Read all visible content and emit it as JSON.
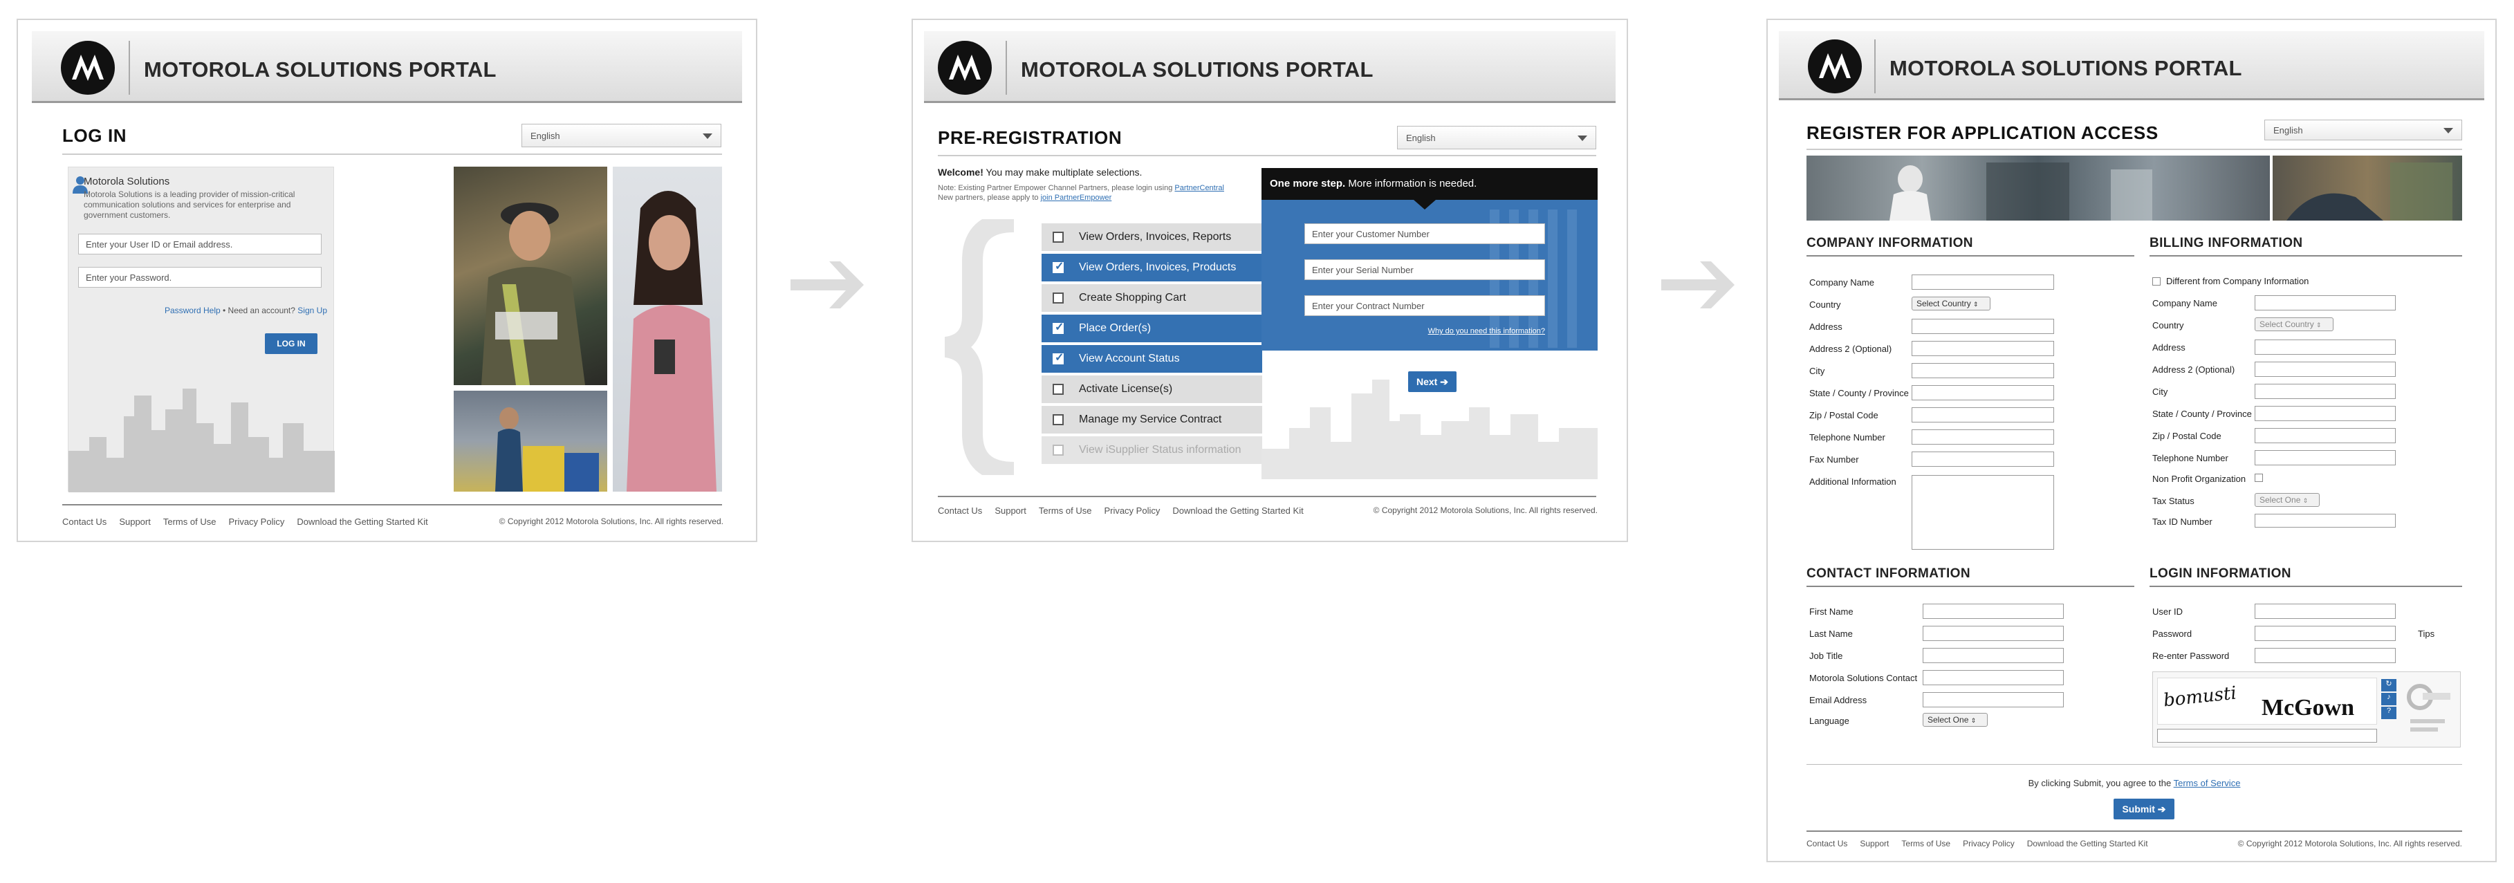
{
  "brand": {
    "title": "MOTOROLA SOLUTIONS PORTAL"
  },
  "language_select": {
    "value": "English"
  },
  "login": {
    "page_title": "LOG IN",
    "company_name": "Motorola Solutions",
    "company_desc": "Motorola Solutions is a leading provider of mission-critical communication solutions and services for enterprise and government customers.",
    "user_placeholder": "Enter your User ID or Email address.",
    "password_placeholder": "Enter your Password.",
    "password_help": "Password Help",
    "need_account": "• Need an account?",
    "sign_up": "Sign Up",
    "login_button": "LOG IN"
  },
  "footer": {
    "links": [
      "Contact Us",
      "Support",
      "Terms of Use",
      "Privacy Policy",
      "Download the Getting Started Kit"
    ],
    "copyright": "© Copyright 2012 Motorola Solutions, Inc. All rights reserved."
  },
  "prereg": {
    "page_title": "PRE-REGISTRATION",
    "welcome_bold": "Welcome!",
    "welcome_text": "You may make multiplate selections.",
    "note_line1": "Note: Existing Partner Empower Channel Partners, please login using",
    "note_link1": "PartnerCentral",
    "note_line2": "New partners, please apply to",
    "note_link2": "join PartnerEmpower",
    "options": [
      {
        "label": "View Orders, Invoices, Reports",
        "state": "off"
      },
      {
        "label": "View Orders, Invoices, Products",
        "state": "on"
      },
      {
        "label": "Create Shopping Cart",
        "state": "off"
      },
      {
        "label": "Place Order(s)",
        "state": "on"
      },
      {
        "label": "View Account Status",
        "state": "on"
      },
      {
        "label": "Activate License(s)",
        "state": "off"
      },
      {
        "label": "Manage my Service Contract",
        "state": "off"
      },
      {
        "label": "View iSupplier Status information",
        "state": "dis"
      }
    ],
    "more_bold": "One more step.",
    "more_text": "More information is needed.",
    "customer_placeholder": "Enter your Customer Number",
    "serial_placeholder": "Enter your Serial Number",
    "contract_placeholder": "Enter your Contract Number",
    "why_link": "Why do you need this information?",
    "next_button": "Next"
  },
  "register": {
    "page_title": "REGISTER FOR APPLICATION ACCESS",
    "company_section": "COMPANY INFORMATION",
    "company_fields": [
      "Company Name",
      "Country",
      "Address",
      "Address 2 (Optional)",
      "City",
      "State / County / Province",
      "Zip / Postal Code",
      "Telephone Number",
      "Fax Number",
      "Additional Information"
    ],
    "country_select": "Select Country",
    "billing_section": "BILLING INFORMATION",
    "billing_checkbox": "Different from Company Information",
    "billing_fields": [
      "Company Name",
      "Country",
      "Address",
      "Address 2 (Optional)",
      "City",
      "State / County / Province",
      "Zip / Postal Code",
      "Telephone Number",
      "Non Profit Organization",
      "Tax Status",
      "Tax ID Number"
    ],
    "billing_country_select": "Select Country",
    "tax_status_select": "Select One",
    "contact_section": "CONTACT INFORMATION",
    "contact_fields": [
      "First Name",
      "Last Name",
      "Job Title",
      "Motorola Solutions Contact",
      "Email Address",
      "Language"
    ],
    "language_select": "Select One",
    "login_section": "LOGIN INFORMATION",
    "login_fields": [
      "User ID",
      "Password",
      "Re-enter Password"
    ],
    "tips_link": "Tips",
    "captcha_word1": "bomusti",
    "captcha_word2": "McGown",
    "terms_text": "By clicking Submit, you agree to the",
    "terms_link": "Terms of Service",
    "submit_button": "Submit"
  }
}
